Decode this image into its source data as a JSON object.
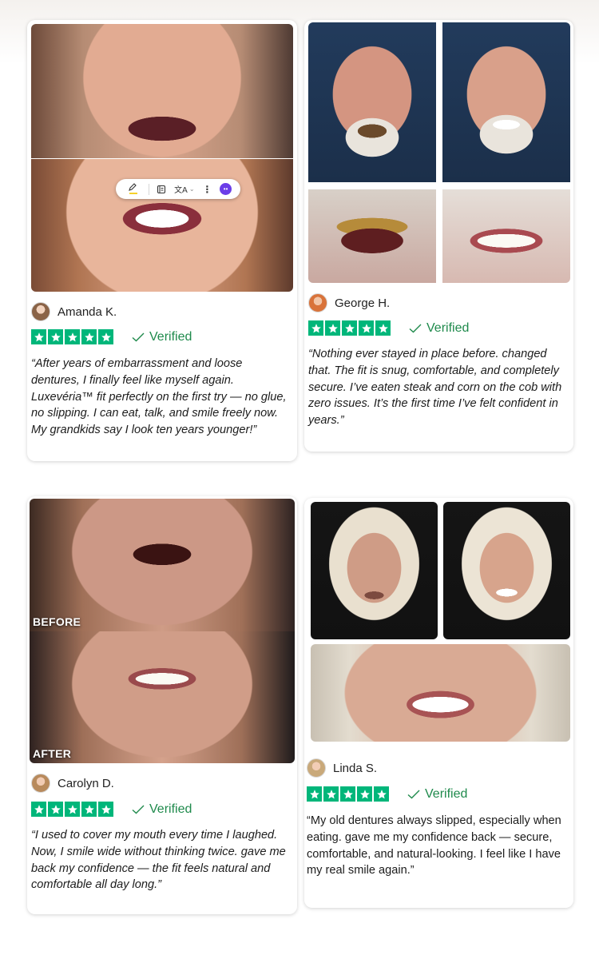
{
  "star_color": "#00b67a",
  "verified_color": "#1f8a4c",
  "toolbar": {
    "icons": [
      "highlighter-icon",
      "note-icon",
      "translate-icon",
      "chevron-down-icon",
      "more-vertical-icon",
      "ai-assistant-icon"
    ],
    "translate_glyph": "文A"
  },
  "reviews": [
    {
      "name": "Amanda K.",
      "rating": 5,
      "verified_label": "Verified",
      "quote": "“After years of embarrassment and loose dentures, I finally feel like myself again. Luxevéria™ fit perfectly on the first try — no glue, no slipping. I can eat, talk, and smile freely now. My grandkids say I look ten years younger!”"
    },
    {
      "name": "George H.",
      "rating": 5,
      "verified_label": "Verified",
      "quote": "“Nothing ever stayed in place before. changed that. The fit is snug, comfortable, and completely secure. I’ve eaten steak and corn on the cob with zero issues. It’s the first time I’ve felt confident in years.”"
    },
    {
      "name": "Carolyn D.",
      "rating": 5,
      "verified_label": "Verified",
      "photo_labels": [
        "BEFORE",
        "AFTER"
      ],
      "quote": "“I used to cover my mouth every time I laughed. Now, I smile wide without thinking twice. gave me back my confidence — the fit feels natural and comfortable all day long.”"
    },
    {
      "name": "Linda S.",
      "rating": 5,
      "verified_label": "Verified",
      "quote": "“My old dentures always slipped, especially when eating. gave me my confidence back — secure, comfortable, and natural-looking. I feel like I have my real smile again.”"
    }
  ]
}
